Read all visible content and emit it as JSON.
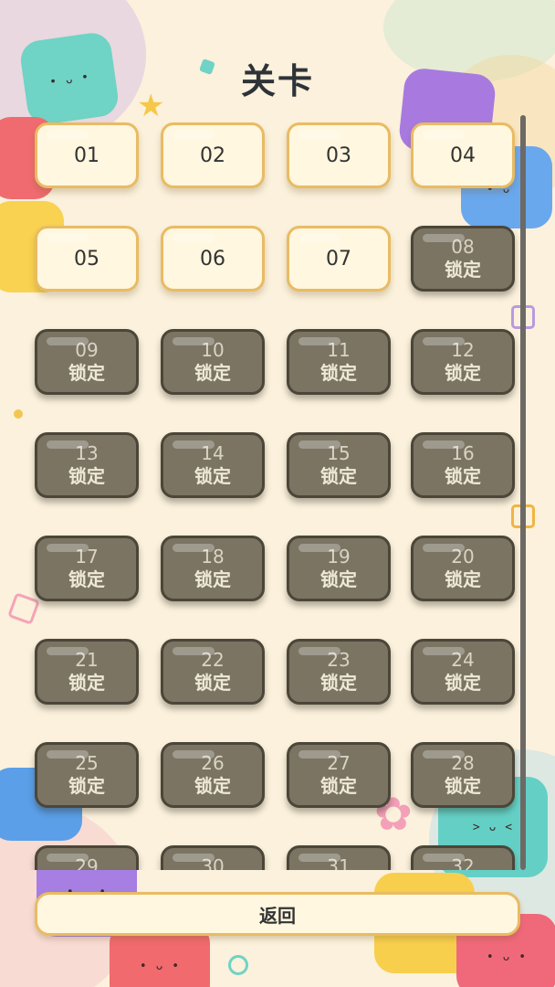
{
  "screen": {
    "title": "关卡",
    "back_label": "返回",
    "locked_label": "锁定"
  },
  "levels": [
    {
      "number": "01",
      "locked": false
    },
    {
      "number": "02",
      "locked": false
    },
    {
      "number": "03",
      "locked": false
    },
    {
      "number": "04",
      "locked": false
    },
    {
      "number": "05",
      "locked": false
    },
    {
      "number": "06",
      "locked": false
    },
    {
      "number": "07",
      "locked": false
    },
    {
      "number": "08",
      "locked": true
    },
    {
      "number": "09",
      "locked": true
    },
    {
      "number": "10",
      "locked": true
    },
    {
      "number": "11",
      "locked": true
    },
    {
      "number": "12",
      "locked": true
    },
    {
      "number": "13",
      "locked": true
    },
    {
      "number": "14",
      "locked": true
    },
    {
      "number": "15",
      "locked": true
    },
    {
      "number": "16",
      "locked": true
    },
    {
      "number": "17",
      "locked": true
    },
    {
      "number": "18",
      "locked": true
    },
    {
      "number": "19",
      "locked": true
    },
    {
      "number": "20",
      "locked": true
    },
    {
      "number": "21",
      "locked": true
    },
    {
      "number": "22",
      "locked": true
    },
    {
      "number": "23",
      "locked": true
    },
    {
      "number": "24",
      "locked": true
    },
    {
      "number": "25",
      "locked": true
    },
    {
      "number": "26",
      "locked": true
    },
    {
      "number": "27",
      "locked": true
    },
    {
      "number": "28",
      "locked": true
    },
    {
      "number": "29",
      "locked": true
    },
    {
      "number": "30",
      "locked": true
    },
    {
      "number": "31",
      "locked": true
    },
    {
      "number": "32",
      "locked": true
    }
  ],
  "colors": {
    "background": "#fbf1dc",
    "open_tile": "#fff7df",
    "open_border": "#e9bb63",
    "locked_tile": "#7b7463",
    "locked_border": "#4b4638"
  }
}
